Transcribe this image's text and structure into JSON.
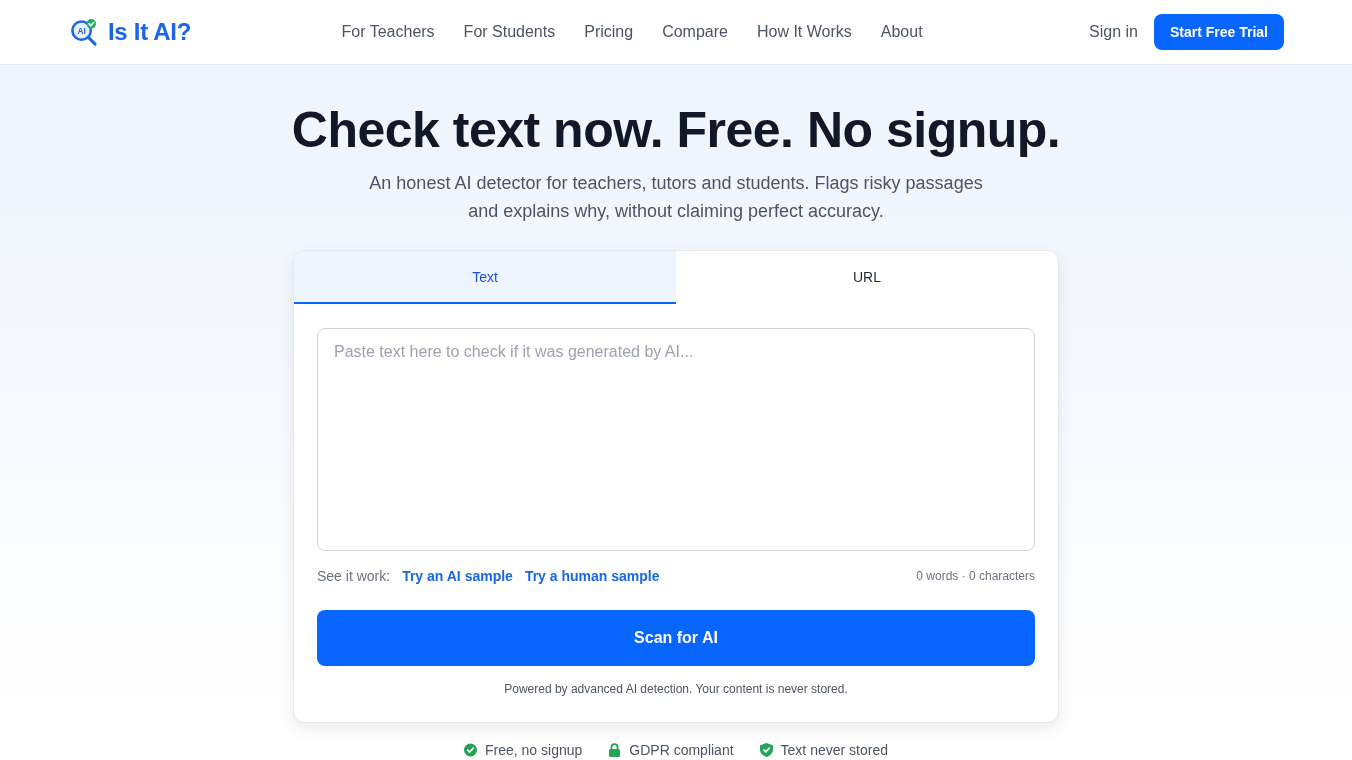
{
  "header": {
    "logo": {
      "mark_text": "AI",
      "text": "Is It AI?"
    },
    "nav": [
      "For Teachers",
      "For Students",
      "Pricing",
      "Compare",
      "How It Works",
      "About"
    ],
    "sign_in": "Sign in",
    "cta": "Start Free Trial"
  },
  "hero": {
    "title": "Check text now. Free. No signup.",
    "subtitle": "An honest AI detector for teachers, tutors and students. Flags risky passages and explains why, without claiming perfect accuracy."
  },
  "checker": {
    "tabs": [
      {
        "label": "Text",
        "selected": true
      },
      {
        "label": "URL",
        "selected": false
      }
    ],
    "input": {
      "placeholder": "Paste text here to check if it was generated by AI..."
    },
    "samples": {
      "label": "See it work:",
      "links": [
        "Try an AI sample",
        "Try a human sample"
      ]
    },
    "counter": "0 words · 0 characters",
    "scan_button": "Scan for AI",
    "note": "Powered by advanced AI detection. Your content is never stored."
  },
  "trust": [
    {
      "kind": "check",
      "label": "Free, no signup"
    },
    {
      "kind": "lock",
      "label": "GDPR compliant"
    },
    {
      "kind": "shield",
      "label": "Text never stored"
    }
  ]
}
